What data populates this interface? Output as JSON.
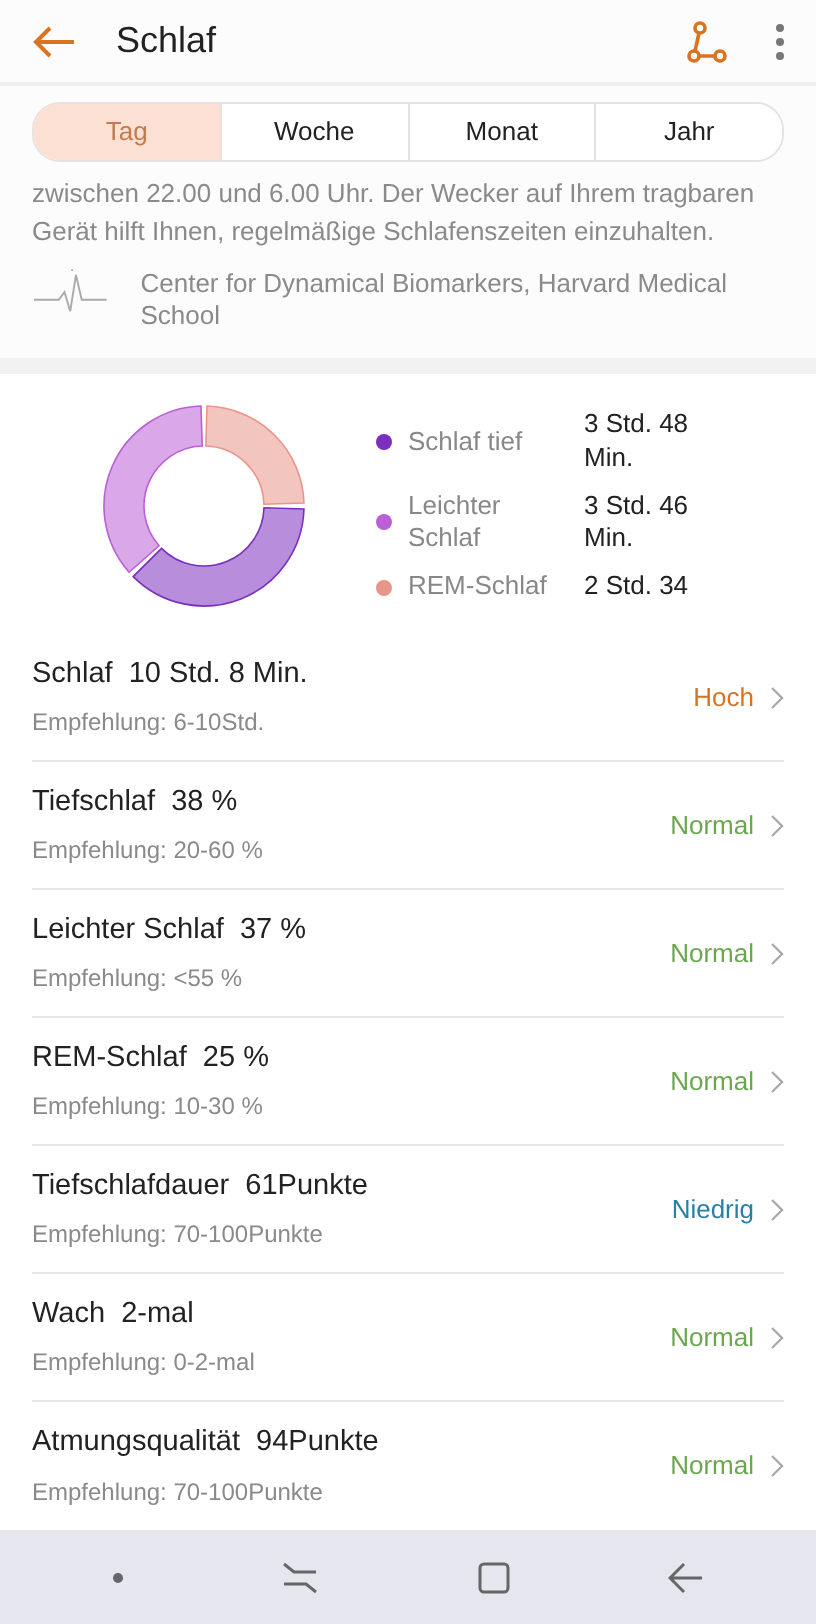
{
  "header": {
    "title": "Schlaf"
  },
  "tabs": [
    {
      "label": "Tag",
      "selected": true
    },
    {
      "label": "Woche",
      "selected": false
    },
    {
      "label": "Monat",
      "selected": false
    },
    {
      "label": "Jahr",
      "selected": false
    }
  ],
  "info": {
    "text": "zwischen 22.00 und 6.00 Uhr. Der Wecker auf Ihrem tragbaren Gerät hilft Ihnen, regelmäßige Schlafenszeiten einzuhalten.",
    "source": "Center for Dynamical Biomarkers, Harvard Medical School"
  },
  "chart_data": {
    "type": "donut",
    "categories": [
      "Schlaf tief",
      "Leichter Schlaf",
      "REM-Schlaf"
    ],
    "series": [
      {
        "values": [
          38,
          37,
          25
        ]
      }
    ]
  },
  "legend": [
    {
      "value": "3 Std. 48 Min.",
      "color": "#7b2fbf"
    },
    {
      "value": "3 Std. 46 Min.",
      "color": "#bb5fd6"
    },
    {
      "value": "2 Std. 34",
      "color": "#e8958a"
    }
  ],
  "metrics": [
    {
      "name": "Schlaf",
      "value": "10 Std. 8 Min.",
      "recommendation": "Empfehlung: 6-10Std.",
      "status": "Hoch",
      "color": "#d9731f"
    },
    {
      "name": "Tiefschlaf",
      "value": "38 %",
      "recommendation": "Empfehlung: 20-60 %",
      "status": "Normal",
      "color": "#6aa84f"
    },
    {
      "name": "Leichter Schlaf",
      "value": "37 %",
      "recommendation": "Empfehlung: <55 %",
      "status": "Normal",
      "color": "#6aa84f"
    },
    {
      "name": "REM-Schlaf",
      "value": "25 %",
      "recommendation": "Empfehlung: 10-30 %",
      "status": "Normal",
      "color": "#6aa84f"
    },
    {
      "name": "Tiefschlafdauer",
      "value": "61Punkte",
      "recommendation": "Empfehlung: 70-100Punkte",
      "status": "Niedrig",
      "color": "#2a7fa6"
    },
    {
      "name": "Wach",
      "value": "2-mal",
      "recommendation": "Empfehlung: 0-2-mal",
      "status": "Normal",
      "color": "#6aa84f"
    },
    {
      "name": "Atmungsqualität",
      "value": "94Punkte",
      "recommendation": "Empfehlung: 70-100Punkte",
      "status": "Normal",
      "color": "#6aa84f"
    }
  ]
}
